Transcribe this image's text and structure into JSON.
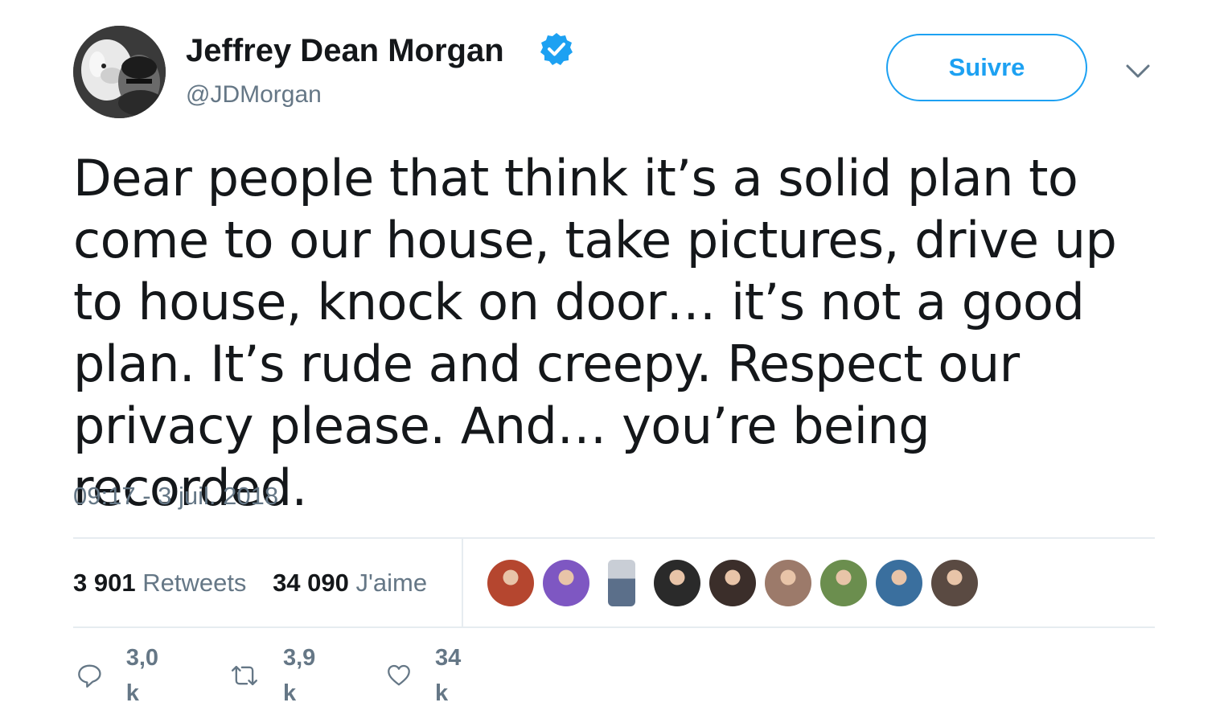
{
  "author": {
    "name": "Jeffrey Dean Morgan",
    "handle": "@JDMorgan",
    "verified": true,
    "avatar_icon": "profile-photo-with-dog"
  },
  "follow_button": {
    "label": "Suivre"
  },
  "more_menu": {
    "icon": "chevron-down-icon"
  },
  "tweet": {
    "text": "Dear people that think it’s a solid plan to come to our house, take pictures, drive up to house, knock on door… it’s not a good plan. It’s rude and creepy. Respect our privacy please. And… you’re being recorded.",
    "timestamp": "09:17 - 3 juil. 2018"
  },
  "stats": {
    "retweets_count": "3 901",
    "retweets_label": "Retweets",
    "likes_count": "34 090",
    "likes_label": "J'aime"
  },
  "likers": [
    {
      "color": "#b5462f"
    },
    {
      "color": "#7e57c2"
    },
    {
      "color": "#5b6f8a"
    },
    {
      "color": "#2a2a2a"
    },
    {
      "color": "#3b2e2a"
    },
    {
      "color": "#9c7a6a"
    },
    {
      "color": "#6b8e4e"
    },
    {
      "color": "#3a6f9e"
    },
    {
      "color": "#5a4a42"
    }
  ],
  "actions": {
    "reply_count": "3,0 k",
    "retweet_count": "3,9 k",
    "like_count": "34 k"
  },
  "colors": {
    "accent": "#1da1f2",
    "secondary_text": "#657786",
    "primary_text": "#14171a",
    "divider": "#e6ecf0"
  }
}
